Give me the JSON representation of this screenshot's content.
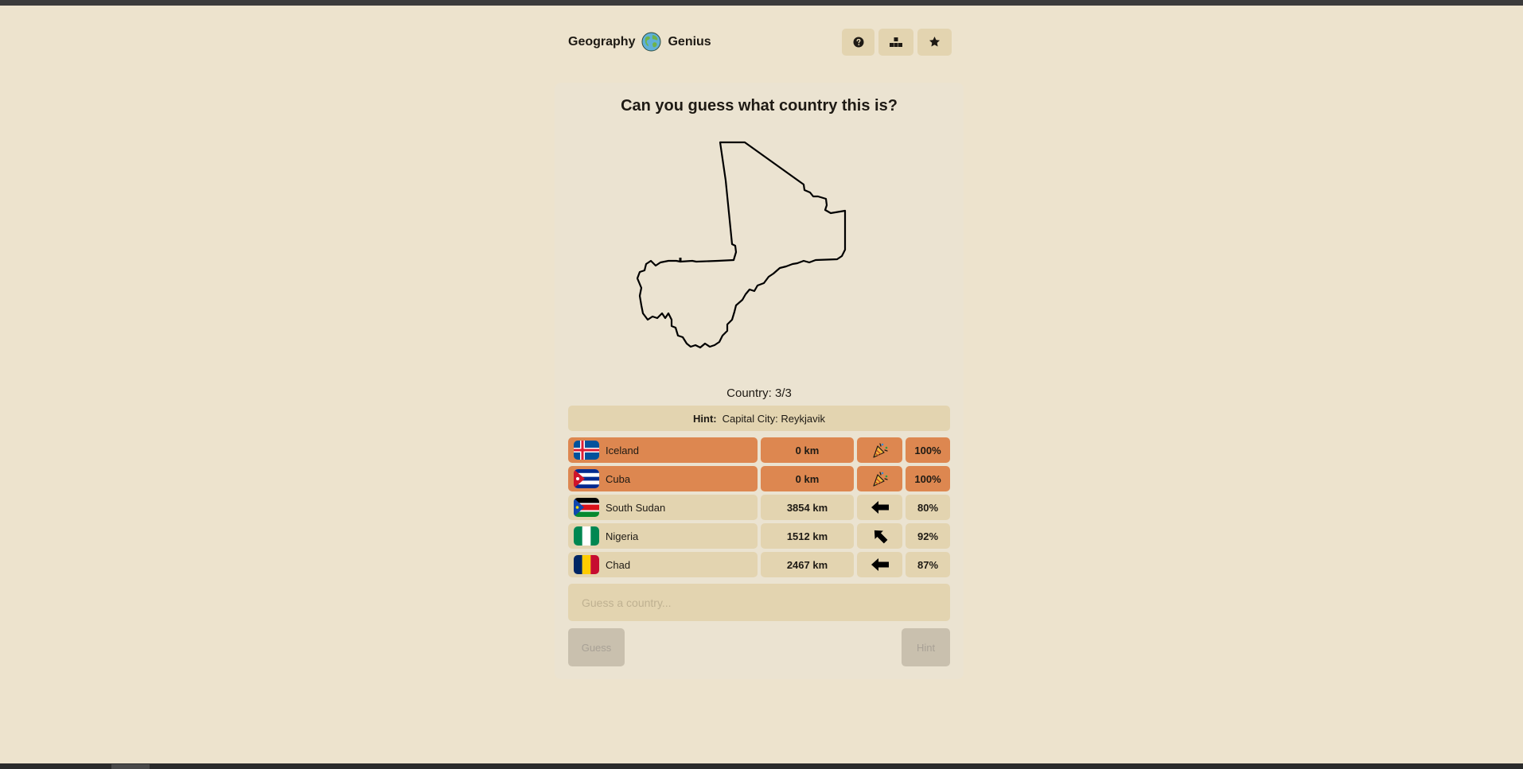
{
  "app": {
    "title_part1": "Geography",
    "title_part2": "Genius",
    "icons": {
      "logo": "globe-icon",
      "help": "question-circle-icon",
      "leaderboard": "podium-icon",
      "favorites": "star-icon"
    }
  },
  "game": {
    "question": "Can you guess what country this is?",
    "counter": "Country: 3/3",
    "hint_label": "Hint:",
    "hint_text": "Capital City: Reykjavik"
  },
  "guesses": [
    {
      "country": "Iceland",
      "distance": "0 km",
      "direction": "party-popper-icon",
      "proximity": "100%",
      "correct": true
    },
    {
      "country": "Cuba",
      "distance": "0 km",
      "direction": "party-popper-icon",
      "proximity": "100%",
      "correct": true
    },
    {
      "country": "South Sudan",
      "distance": "3854 km",
      "direction": "arrow-left-icon",
      "proximity": "80%",
      "correct": false
    },
    {
      "country": "Nigeria",
      "distance": "1512 km",
      "direction": "arrow-up-left-icon",
      "proximity": "92%",
      "correct": false
    },
    {
      "country": "Chad",
      "distance": "2467 km",
      "direction": "arrow-left-icon",
      "proximity": "87%",
      "correct": false
    }
  ],
  "input": {
    "placeholder": "Guess a country...",
    "value": ""
  },
  "buttons": {
    "guess": "Guess",
    "hint": "Hint"
  },
  "colors": {
    "background": "#ede3cd",
    "card": "#ebe3d1",
    "cell": "#e3d4b0",
    "correct": "#dd8750"
  }
}
